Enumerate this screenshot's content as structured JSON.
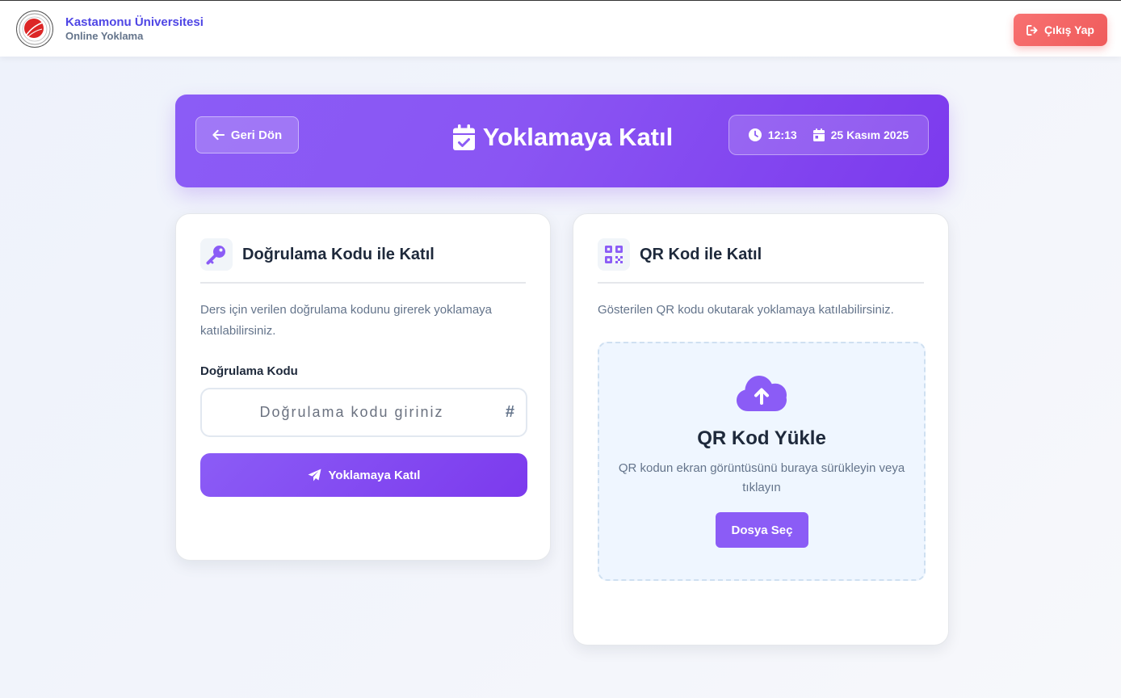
{
  "navbar": {
    "university": "Kastamonu Üniversitesi",
    "subtitle": "Online Yoklama",
    "logout_label": "Çıkış Yap"
  },
  "banner": {
    "back_label": "Geri Dön",
    "title": "Yoklamaya Katıl",
    "time": "12:13",
    "date": "25 Kasım 2025"
  },
  "code_card": {
    "title": "Doğrulama Kodu ile Katıl",
    "description": "Ders için verilen doğrulama kodunu girerek yoklamaya katılabilirsiniz.",
    "field_label": "Doğrulama Kodu",
    "input_value": "",
    "input_placeholder": "Doğrulama kodu giriniz",
    "hash_symbol": "#",
    "submit_label": "Yoklamaya Katıl"
  },
  "qr_card": {
    "title": "QR Kod ile Katıl",
    "description": "Gösterilen QR kodu okutarak yoklamaya katılabilirsiniz.",
    "upload_title": "QR Kod Yükle",
    "upload_hint": "QR kodun ekran görüntüsünü buraya sürükleyin veya tıklayın",
    "file_button_label": "Dosya Seç"
  },
  "colors": {
    "accent": "#8b5cf6",
    "brand_text": "#4f46e5",
    "danger": "#ef5b5b",
    "dropzone_bg": "#eff6ff"
  },
  "icons": {
    "logo": "university-seal-icon",
    "logout": "sign-out-icon",
    "back": "arrow-left-icon",
    "title": "calendar-check-icon",
    "time": "clock-icon",
    "date": "calendar-icon",
    "code_card": "key-icon",
    "qr_card": "qrcode-icon",
    "submit": "paper-plane-icon",
    "upload": "cloud-upload-icon"
  }
}
